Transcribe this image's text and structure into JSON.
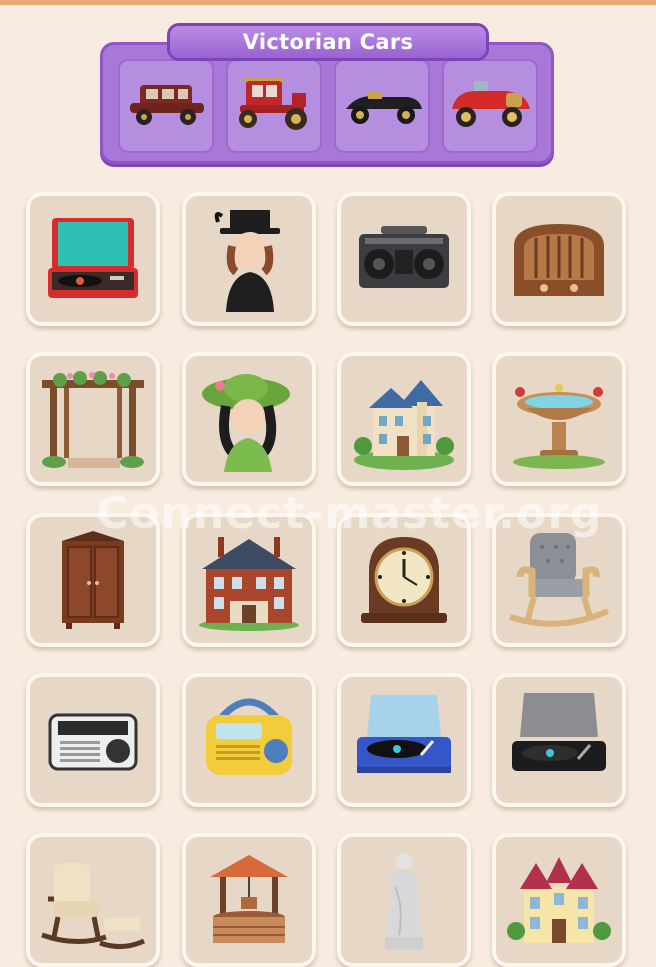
{
  "category": {
    "title": "Victorian Cars",
    "slots": [
      "vintage-sedan-icon",
      "red-carriage-car-icon",
      "black-roadster-icon",
      "red-racer-car-icon"
    ]
  },
  "watermark": "Connect-master.org",
  "grid": {
    "rows": [
      [
        "red-record-player-icon",
        "victorian-lady-top-hat-icon",
        "boombox-icon",
        "wooden-radio-icon"
      ],
      [
        "garden-pergola-icon",
        "lady-green-hat-icon",
        "victorian-mansion-icon",
        "bird-bath-icon"
      ],
      [
        "wooden-wardrobe-icon",
        "brick-manor-house-icon",
        "mantel-clock-icon",
        "rocking-chair-icon"
      ],
      [
        "white-radio-icon",
        "yellow-radio-icon",
        "blue-record-player-icon",
        "black-turntable-icon"
      ],
      [
        "rocking-chair-ottoman-icon",
        "wishing-well-icon",
        "marble-statue-icon",
        "victorian-house-icon"
      ]
    ]
  },
  "colors": {
    "background": "#f7ecdf",
    "tile": "#e7d7c7",
    "panel": "#a877d8",
    "panel_border": "#8e56c9",
    "accent_top": "#e9a775"
  }
}
